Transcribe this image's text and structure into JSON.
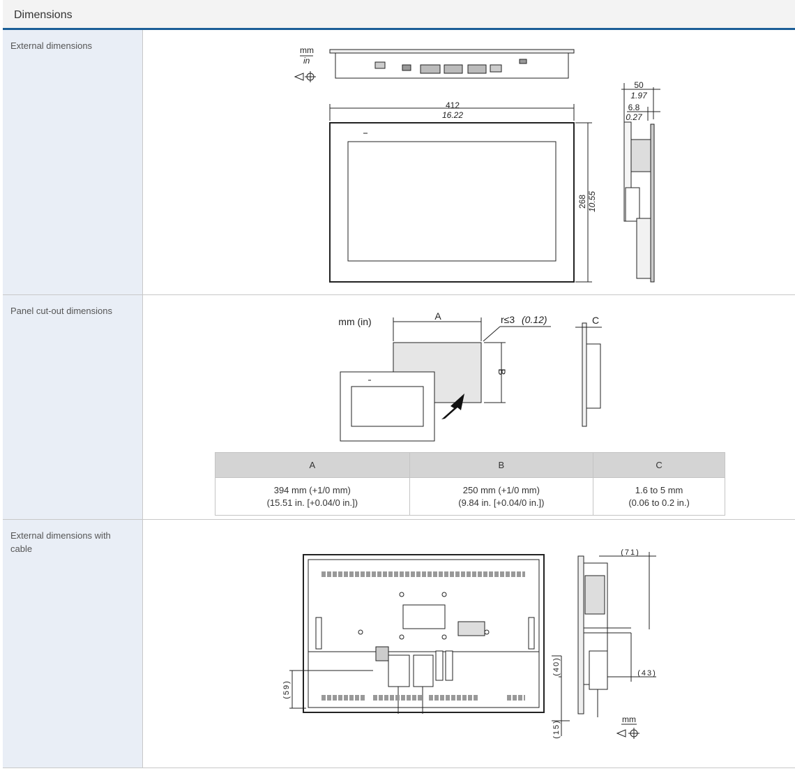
{
  "header": {
    "title": "Dimensions"
  },
  "sections": [
    {
      "label": "External dimensions"
    },
    {
      "label": "Panel cut-out dimensions"
    },
    {
      "label": "External dimensions with cable"
    }
  ],
  "external": {
    "unit_mm": "mm",
    "unit_in": "in",
    "width_mm": "412",
    "width_in": "16.22",
    "height_mm": "268",
    "height_in": "10.55",
    "depth_mm": "50",
    "depth_in": "1.97",
    "bezel_mm": "6.8",
    "bezel_in": "0.27"
  },
  "cutout": {
    "unit": "mm (in)",
    "label_a": "A",
    "label_b": "B",
    "label_c": "C",
    "radius": "r≤3",
    "radius_in": "(0.12)",
    "table": {
      "headers": [
        "A",
        "B",
        "C"
      ],
      "rows": [
        [
          "394 mm (+1/0 mm)",
          "250 mm (+1/0 mm)",
          "1.6 to 5 mm"
        ],
        [
          "(15.51 in. [+0.04/0 in.])",
          "(9.84 in. [+0.04/0 in.])",
          "(0.06 to 0.2 in.)"
        ]
      ]
    }
  },
  "cable": {
    "dim_71": "(71)",
    "dim_43": "(43)",
    "dim_40": "(40)",
    "dim_59": "(59)",
    "dim_15": "(15)",
    "unit": "mm"
  }
}
